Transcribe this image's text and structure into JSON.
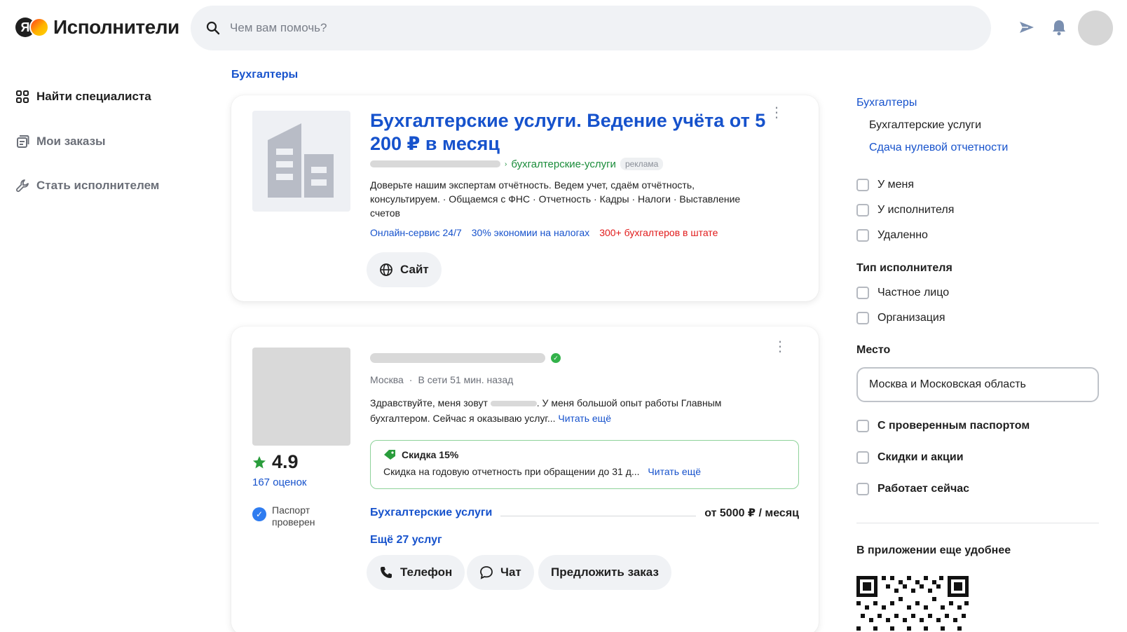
{
  "header": {
    "logo_letter": "Я",
    "logo_text": "Исполнители",
    "search_placeholder": "Чем вам помочь?",
    "icons": [
      "search-icon",
      "send-icon",
      "bell-icon",
      "avatar"
    ]
  },
  "nav": {
    "items": [
      {
        "label": "Найти специалиста",
        "icon": "grid-icon"
      },
      {
        "label": "Мои заказы",
        "icon": "orders-icon"
      },
      {
        "label": "Стать исполнителем",
        "icon": "wrench-icon"
      }
    ]
  },
  "breadcrumb": "Бухгалтеры",
  "ad_card": {
    "title": "Бухгалтерские услуги. Ведение учёта от 5 200 ₽ в месяц",
    "url_text": "бухгалтерские-услуги",
    "badge": "реклама",
    "description": "Доверьте нашим экспертам отчётность. Ведем учет, сдаём отчётность, консультируем.  ·  Общаемся с ФНС  ·  Отчетность  ·  Кадры  ·  Налоги  ·  Выставление счетов",
    "links": [
      {
        "text": "Онлайн-сервис 24/7",
        "color": "#1652cc"
      },
      {
        "text": "30% экономии на налогах",
        "color": "#1652cc"
      },
      {
        "text": "300+ бухгалтеров в штате",
        "color": "#e11b1b"
      }
    ],
    "site_button": "Сайт"
  },
  "specialist_card": {
    "rating": "4.9",
    "rating_count": "167 оценок",
    "passport": [
      "Паспорт",
      "проверен"
    ],
    "city": "Москва",
    "online": "В сети 51 мин. назад",
    "bio_start": "Здравствуйте, меня зовут",
    "bio_end": ". У меня большой опыт работы Главным бухгалтером. Сейчас я оказываю услуг...",
    "read_more": "Читать ещё",
    "promo_title": "Скидка 15%",
    "promo_text": "Скидка на годовую отчетность при обращении до 31 д...",
    "promo_read_more": "Читать ещё",
    "service_name": "Бухгалтерские услуги",
    "service_price": "от 5000 ₽ / месяц",
    "more_services": "Ещё 27 услуг",
    "buttons": {
      "phone": "Телефон",
      "chat": "Чат",
      "offer": "Предложить заказ"
    }
  },
  "sidebar": {
    "category": "Бухгалтеры",
    "sub_current": "Бухгалтерские услуги",
    "sub_link": "Сдача нулевой отчетности",
    "location_options": [
      "У меня",
      "У исполнителя",
      "Удаленно"
    ],
    "type_heading": "Тип исполнителя",
    "type_options": [
      "Частное лицо",
      "Организация"
    ],
    "place_heading": "Место",
    "place_value": "Москва и Московская область",
    "extra_options": [
      "С проверенным паспортом",
      "Скидки и акции",
      "Работает сейчас"
    ],
    "app_heading": "В приложении еще удобнее"
  },
  "colors": {
    "link": "#1652cc",
    "ad_url": "#1a8c3a",
    "accent_red": "#e11b1b",
    "online": "#33b24a",
    "promo_border": "#8ed29a",
    "rating_star": "#2a9d3c"
  }
}
